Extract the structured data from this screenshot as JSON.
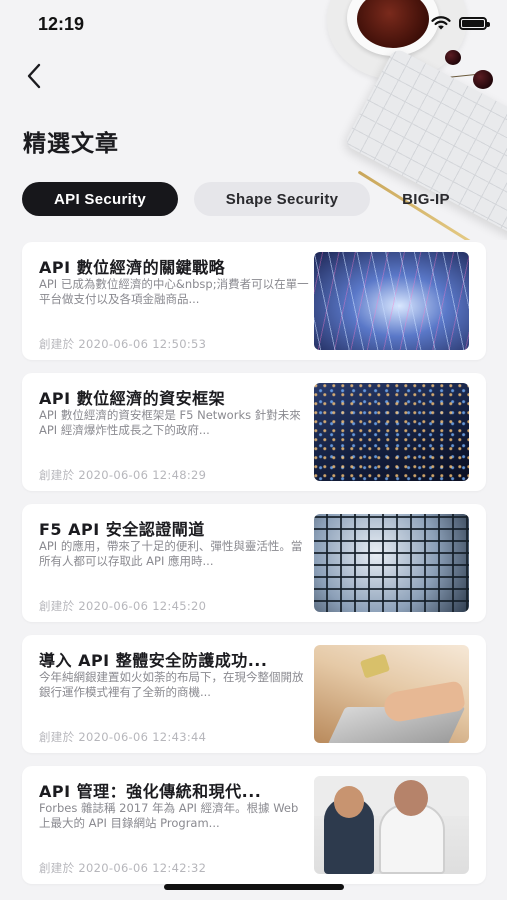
{
  "status_bar": {
    "time": "12:19"
  },
  "header": {
    "title": "精選文章",
    "back_icon": "chevron-left-icon"
  },
  "tabs": [
    {
      "label": "API Security",
      "active": true
    },
    {
      "label": "Shape Security",
      "active": false
    },
    {
      "label": "BIG-IP",
      "active": false
    }
  ],
  "date_prefix": "創建於",
  "articles": [
    {
      "title": "API 數位經濟的關鍵戰略",
      "excerpt": "API 已成為數位經濟的中心&nbsp;消費者可以在單一平台做支付以及各項金融商品...",
      "date": "2020-06-06 12:50:53"
    },
    {
      "title": "API 數位經濟的資安框架",
      "excerpt": "API 數位經濟的資安框架是 F5 Networks 針對未來 API 經濟爆炸性成長之下的政府...",
      "date": "2020-06-06 12:48:29"
    },
    {
      "title": "F5 API 安全認證閘道",
      "excerpt": "API 的應用，帶來了十足的便利、彈性與靈活性。當所有人都可以存取此 API 應用時...",
      "date": "2020-06-06 12:45:20"
    },
    {
      "title": "導入 API 整體安全防護成功...",
      "excerpt": "今年純網銀建置如火如荼的布局下，在現今整個開放銀行運作模式裡有了全新的商機...",
      "date": "2020-06-06 12:43:44"
    },
    {
      "title": "API 管理：強化傳統和現代...",
      "excerpt": "Forbes 雜誌稱 2017 年為 API 經濟年。根據 Web 上最大的 API 目錄網站 Program...",
      "date": "2020-06-06 12:42:32"
    }
  ],
  "colors": {
    "tab_active_bg": "#17171b",
    "tab_inactive_bg": "#e6e6ea",
    "background": "#f3f3f5"
  }
}
